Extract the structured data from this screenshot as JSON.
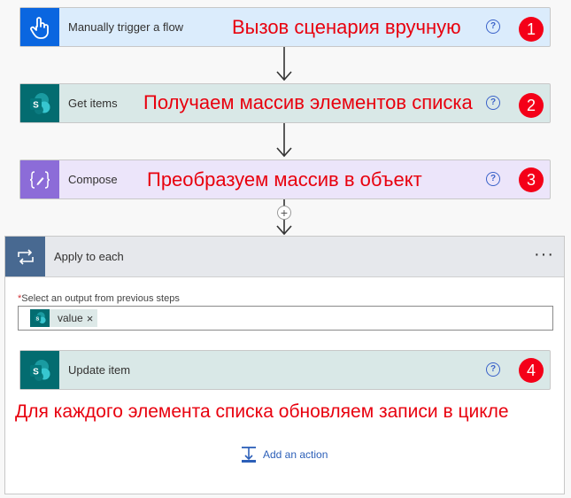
{
  "steps": [
    {
      "title": "Manually trigger a flow",
      "note": "Вызов сценария вручную",
      "number": "1",
      "help": "?"
    },
    {
      "title": "Get items",
      "note": "Получаем массив элементов списка",
      "number": "2",
      "help": "?"
    },
    {
      "title": "Compose",
      "note": "Преобразуем массив в объект",
      "number": "3",
      "help": "?"
    }
  ],
  "apply_each": {
    "title": "Apply to each",
    "more": "···",
    "field_required": "*",
    "field_label": "Select an output from previous steps",
    "token_label": "value",
    "token_remove": "×",
    "inner_step": {
      "title": "Update item",
      "help": "?",
      "number": "4"
    },
    "note": "Для каждого элемента списка обновляем записи в цикле",
    "add_action": "Add an action"
  },
  "sharepoint_letter": "S",
  "colors": {
    "trigger_bg": "#dbecfc",
    "trigger_icon": "#0a66e0",
    "sp_bg": "#d9e8e7",
    "sp_icon": "#036c70",
    "compose_bg": "#ece5fa",
    "compose_icon": "#8c6cd8",
    "loop_header": "#e6e8ec",
    "loop_icon": "#486991",
    "accent_red": "#e8000e",
    "link_blue": "#2c5fb8"
  }
}
